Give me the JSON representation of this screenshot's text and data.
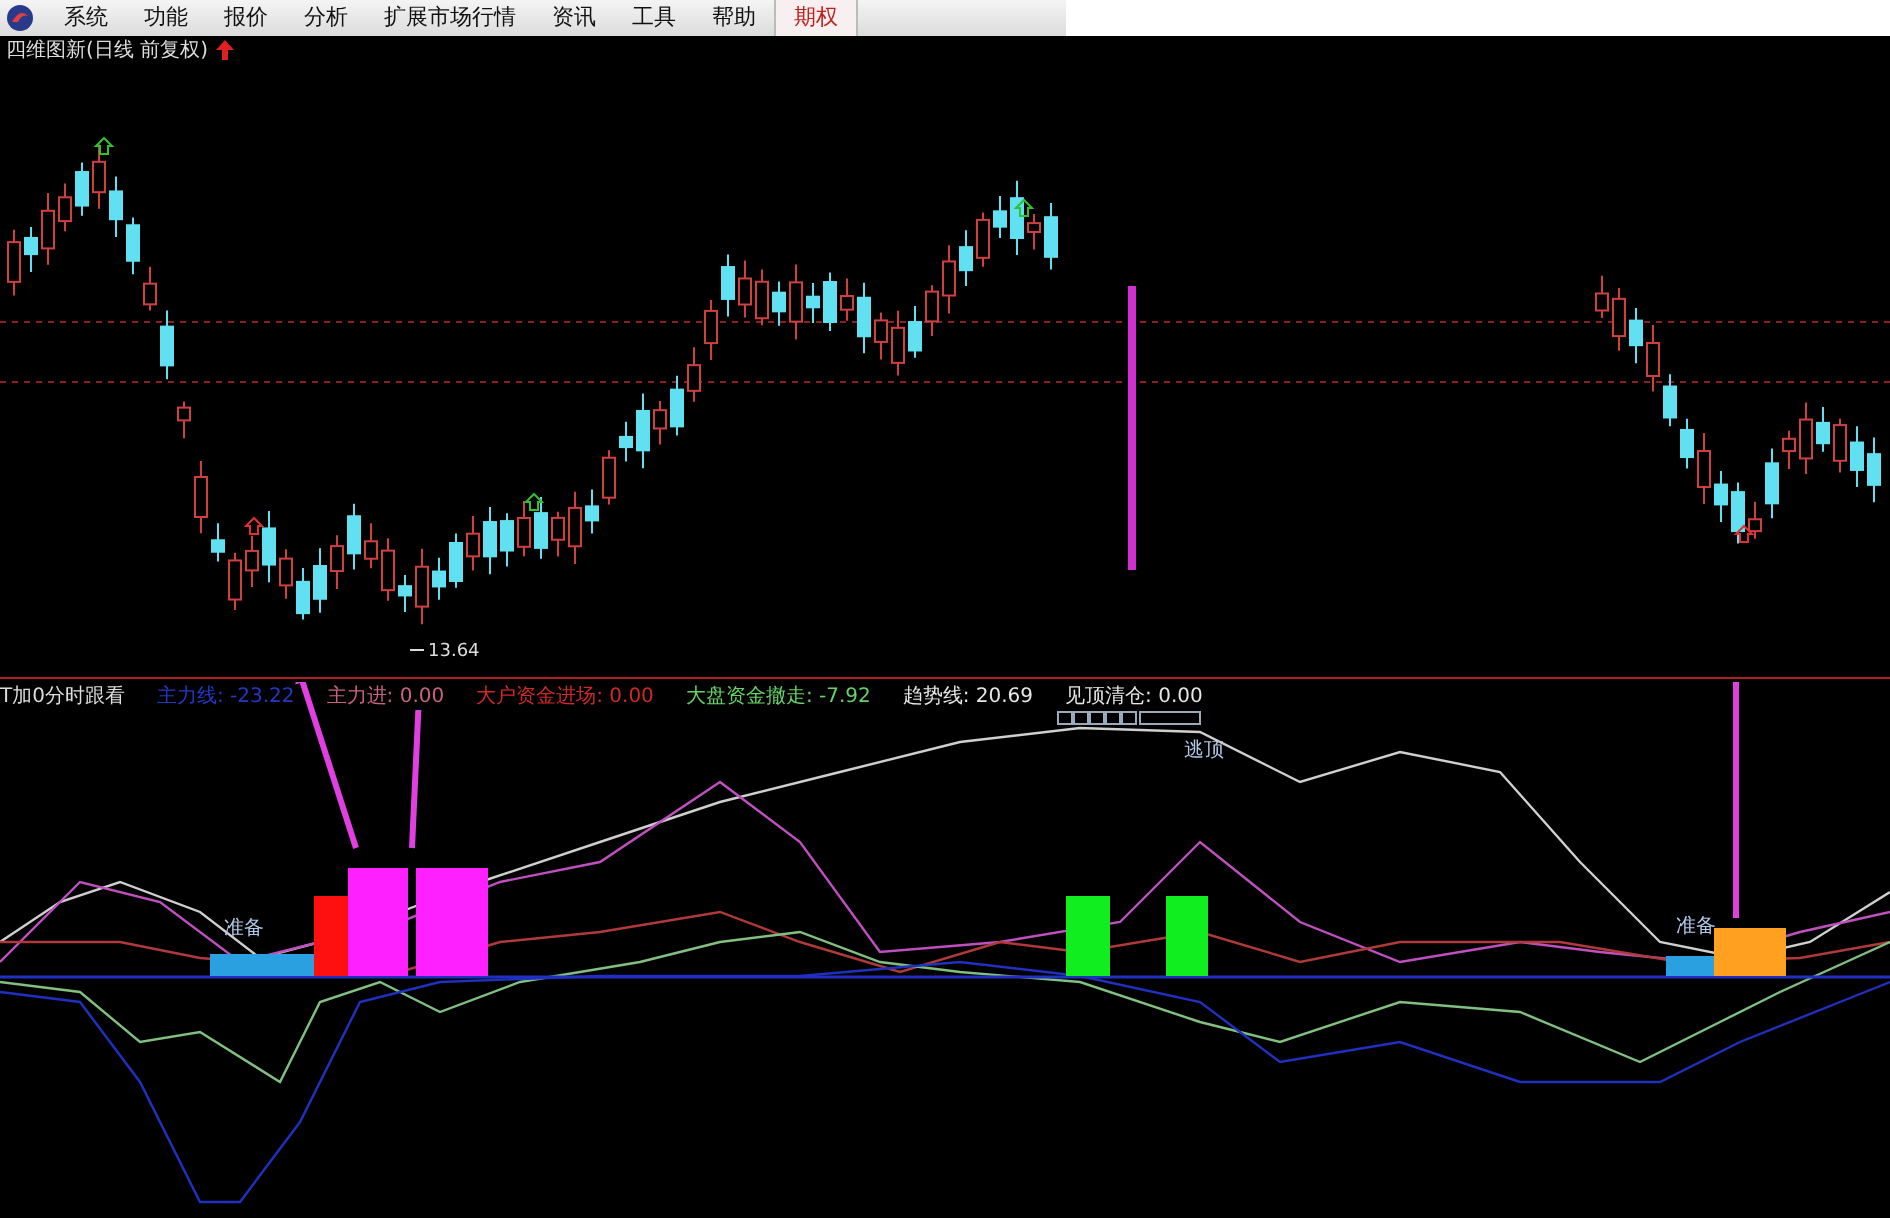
{
  "menu": {
    "items": [
      {
        "label": "系统",
        "selected": false
      },
      {
        "label": "功能",
        "selected": false
      },
      {
        "label": "报价",
        "selected": false
      },
      {
        "label": "分析",
        "selected": false
      },
      {
        "label": "扩展市场行情",
        "selected": false
      },
      {
        "label": "资讯",
        "selected": false
      },
      {
        "label": "工具",
        "selected": false
      },
      {
        "label": "帮助",
        "selected": false
      },
      {
        "label": "期权",
        "selected": true
      }
    ]
  },
  "chart_title": {
    "text": "四维图新(日线 前复权)"
  },
  "price_chart": {
    "low_price_label": "13.64"
  },
  "indicator": {
    "name": "T加0分时跟看",
    "readings": [
      {
        "label": "主力线:",
        "value": "-23.22",
        "color": "#2438c8"
      },
      {
        "label": "主力进:",
        "value": "0.00",
        "color": "#c86482"
      },
      {
        "label": "大户资金进场:",
        "value": "0.00",
        "color": "#d02828"
      },
      {
        "label": "大盘资金撤走:",
        "value": "-7.92",
        "color": "#64d264"
      },
      {
        "label": "趋势线:",
        "value": "20.69",
        "color": "#e6e6e6"
      },
      {
        "label": "见顶清仓:",
        "value": "0.00",
        "color": "#e6e6e6"
      }
    ]
  },
  "signals": [
    {
      "color": "#2aa0e0"
    },
    {
      "color": "#ff1010"
    },
    {
      "color": "#ff20ff"
    },
    {
      "color": "#ff20ff"
    },
    {
      "color": "#10ee20"
    },
    {
      "color": "#10ee20"
    },
    {
      "color": "#2aa0e0"
    },
    {
      "color": "#ffa020"
    }
  ],
  "signal_labels": [
    {
      "text": "准备"
    },
    {
      "text": "逃顶"
    },
    {
      "text": "准备"
    }
  ]
}
